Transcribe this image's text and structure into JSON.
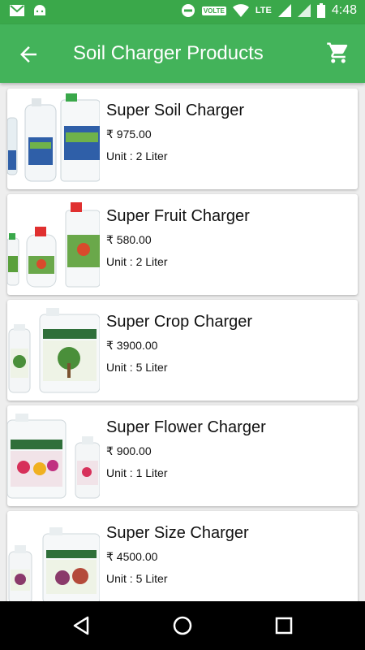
{
  "status_bar": {
    "time": "4:48",
    "volte_label": "VOLTE",
    "network_label": "LTE",
    "icons": [
      "gmail-icon",
      "android-icon",
      "do-not-disturb-icon",
      "wifi-icon",
      "signal-icon",
      "battery-icon"
    ]
  },
  "app_bar": {
    "title": "Soil Charger Products",
    "back_icon": "back-arrow-icon",
    "cart_icon": "cart-icon"
  },
  "products": [
    {
      "name": "Super Soil Charger",
      "price": "₹ 975.00",
      "unit": "Unit : 2 Liter"
    },
    {
      "name": "Super Fruit Charger",
      "price": "₹ 580.00",
      "unit": "Unit : 2 Liter"
    },
    {
      "name": "Super Crop Charger",
      "price": "₹ 3900.00",
      "unit": "Unit : 5 Liter"
    },
    {
      "name": "Super Flower Charger",
      "price": "₹ 900.00",
      "unit": "Unit : 1 Liter"
    },
    {
      "name": "Super Size Charger",
      "price": "₹ 4500.00",
      "unit": "Unit : 5 Liter"
    }
  ],
  "nav_bar": {
    "icons": [
      "nav-back-icon",
      "nav-home-icon",
      "nav-recents-icon"
    ]
  },
  "colors": {
    "primary": "#43b35a",
    "status_bar": "#3aa84a",
    "background": "#eeeeee"
  }
}
